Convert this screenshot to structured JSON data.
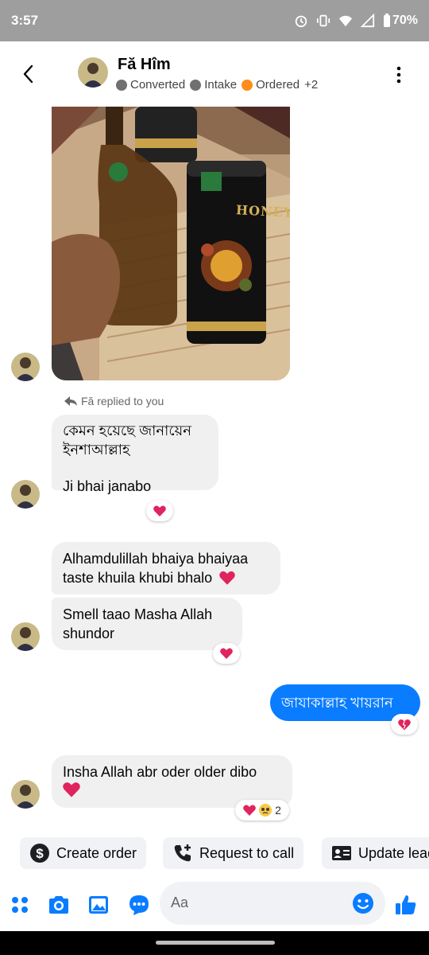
{
  "status": {
    "time": "3:57",
    "battery": "70%"
  },
  "contact": {
    "name": "Fă Hîm",
    "tags": [
      {
        "label": "Converted",
        "color": "#707070"
      },
      {
        "label": "Intake",
        "color": "#707070"
      },
      {
        "label": "Ordered",
        "color": "#ff8c1a"
      }
    ],
    "more": "+2"
  },
  "messages": {
    "reply_note": "Fă replied to you",
    "m1_line1": "কেমন হয়েছে জানায়েন",
    "m1_line2": "ইনশাআল্লাহ",
    "m1_line3": "Ji bhai janabo",
    "m2": "Alhamdulillah bhaiya bhaiyaa taste khuila khubi bhalo",
    "m3": "Smell taao Masha Allah shundor",
    "m4": "জাযাকাল্লাহ খায়রান",
    "m5": "Insha Allah abr oder older dibo",
    "m5_reaction_count": "2"
  },
  "actions": {
    "create_order": "Create order",
    "request_call": "Request to call",
    "update_lead": "Update lead"
  },
  "composer": {
    "placeholder": "Aa"
  },
  "colors": {
    "accent": "#0a7cff",
    "bubble_in": "#f0f0f0",
    "heart": "#e0245e"
  }
}
